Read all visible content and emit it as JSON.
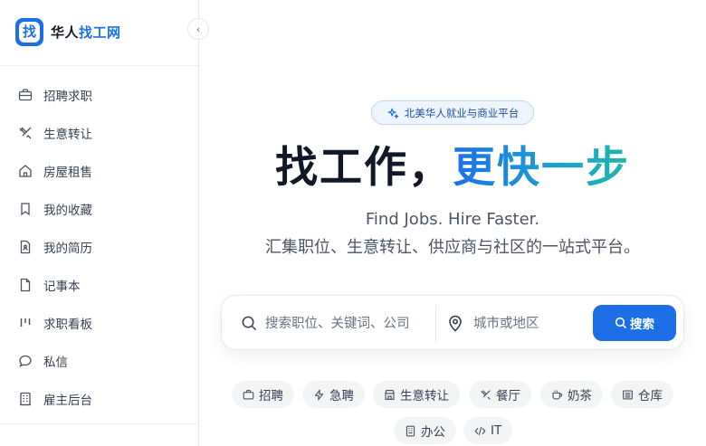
{
  "brand": {
    "logo_char": "找",
    "name_part1": "华人",
    "name_part2": "找工网"
  },
  "sidebar": {
    "items": [
      {
        "label": "招聘求职",
        "icon": "briefcase-icon"
      },
      {
        "label": "生意转让",
        "icon": "handshake-icon"
      },
      {
        "label": "房屋租售",
        "icon": "home-icon"
      },
      {
        "label": "我的收藏",
        "icon": "bookmark-icon"
      },
      {
        "label": "我的简历",
        "icon": "resume-icon"
      },
      {
        "label": "记事本",
        "icon": "notebook-icon"
      },
      {
        "label": "求职看板",
        "icon": "kanban-icon"
      },
      {
        "label": "私信",
        "icon": "message-icon"
      },
      {
        "label": "雇主后台",
        "icon": "building-icon"
      }
    ]
  },
  "hero": {
    "badge": "北美华人就业与商业平台",
    "title_part1": "找工作，",
    "title_part2": "更快一步",
    "subtitle_en": "Find Jobs. Hire Faster.",
    "subtitle_zh": "汇集职位、生意转让、供应商与社区的一站式平台。"
  },
  "search": {
    "keyword_placeholder": "搜索职位、关键词、公司",
    "location_placeholder": "城市或地区",
    "button_label": "搜索"
  },
  "chips": [
    {
      "label": "招聘",
      "icon": "briefcase-icon"
    },
    {
      "label": "急聘",
      "icon": "lightning-icon"
    },
    {
      "label": "生意转让",
      "icon": "store-icon"
    },
    {
      "label": "餐厅",
      "icon": "utensils-icon"
    },
    {
      "label": "奶茶",
      "icon": "cup-icon"
    },
    {
      "label": "仓库",
      "icon": "warehouse-icon"
    },
    {
      "label": "办公",
      "icon": "office-icon"
    },
    {
      "label": "IT",
      "icon": "code-icon"
    }
  ],
  "colors": {
    "accent": "#1d6fe8",
    "gradient_end": "#1fb7a6"
  }
}
